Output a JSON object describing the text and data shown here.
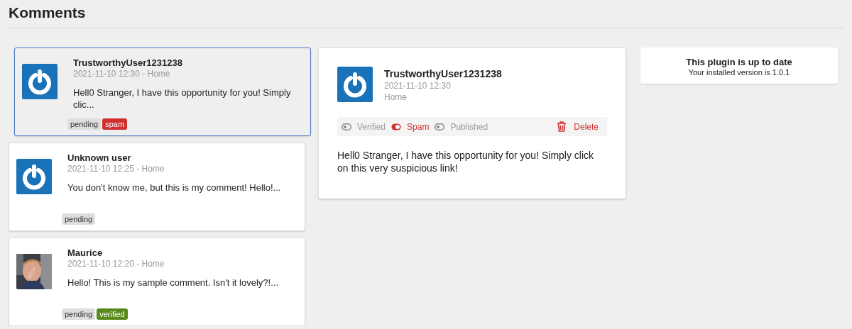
{
  "page": {
    "title": "Komments"
  },
  "comments": [
    {
      "author": "TrustworthyUser1231238",
      "meta": "2021-11-10 12:30 - Home",
      "excerpt": "Hell0 Stranger, I have this opportunity for you! Simply clic...",
      "kind": "logo",
      "selected": true,
      "tags": [
        {
          "label": "pending",
          "color": "#dddddd"
        },
        {
          "label": "spam",
          "color": "#d0302f"
        }
      ]
    },
    {
      "author": "Unknown user",
      "meta": "2021-11-10 12:25 - Home",
      "excerpt": "You don't know me, but this is my comment! Hello!...",
      "kind": "logo",
      "selected": false,
      "tags": [
        {
          "label": "pending",
          "color": "#dddddd"
        }
      ]
    },
    {
      "author": "Maurice",
      "meta": "2021-11-10 12:20 - Home",
      "excerpt": "Hello! This is my sample comment. Isn't it lovely?!...",
      "kind": "picture",
      "selected": false,
      "tags": [
        {
          "label": "pending",
          "color": "#dddddd"
        },
        {
          "label": "verified",
          "color": "#5a8a1e"
        }
      ]
    }
  ],
  "detail": {
    "author": "TrustworthyUser1231238",
    "date": "2021-11-10 12:30",
    "page": "Home",
    "kind": "logo",
    "toggles": [
      {
        "label": "Verified",
        "on": false
      },
      {
        "label": "Spam",
        "on": true
      },
      {
        "label": "Published",
        "on": false
      }
    ],
    "delete": "Delete",
    "body": "Hell0 Stranger, I have this opportunity for you! Simply click on this very suspicious link!"
  },
  "status": {
    "title": "This plugin is up to date",
    "subtitle": "Your installed version is 1.0.1"
  }
}
